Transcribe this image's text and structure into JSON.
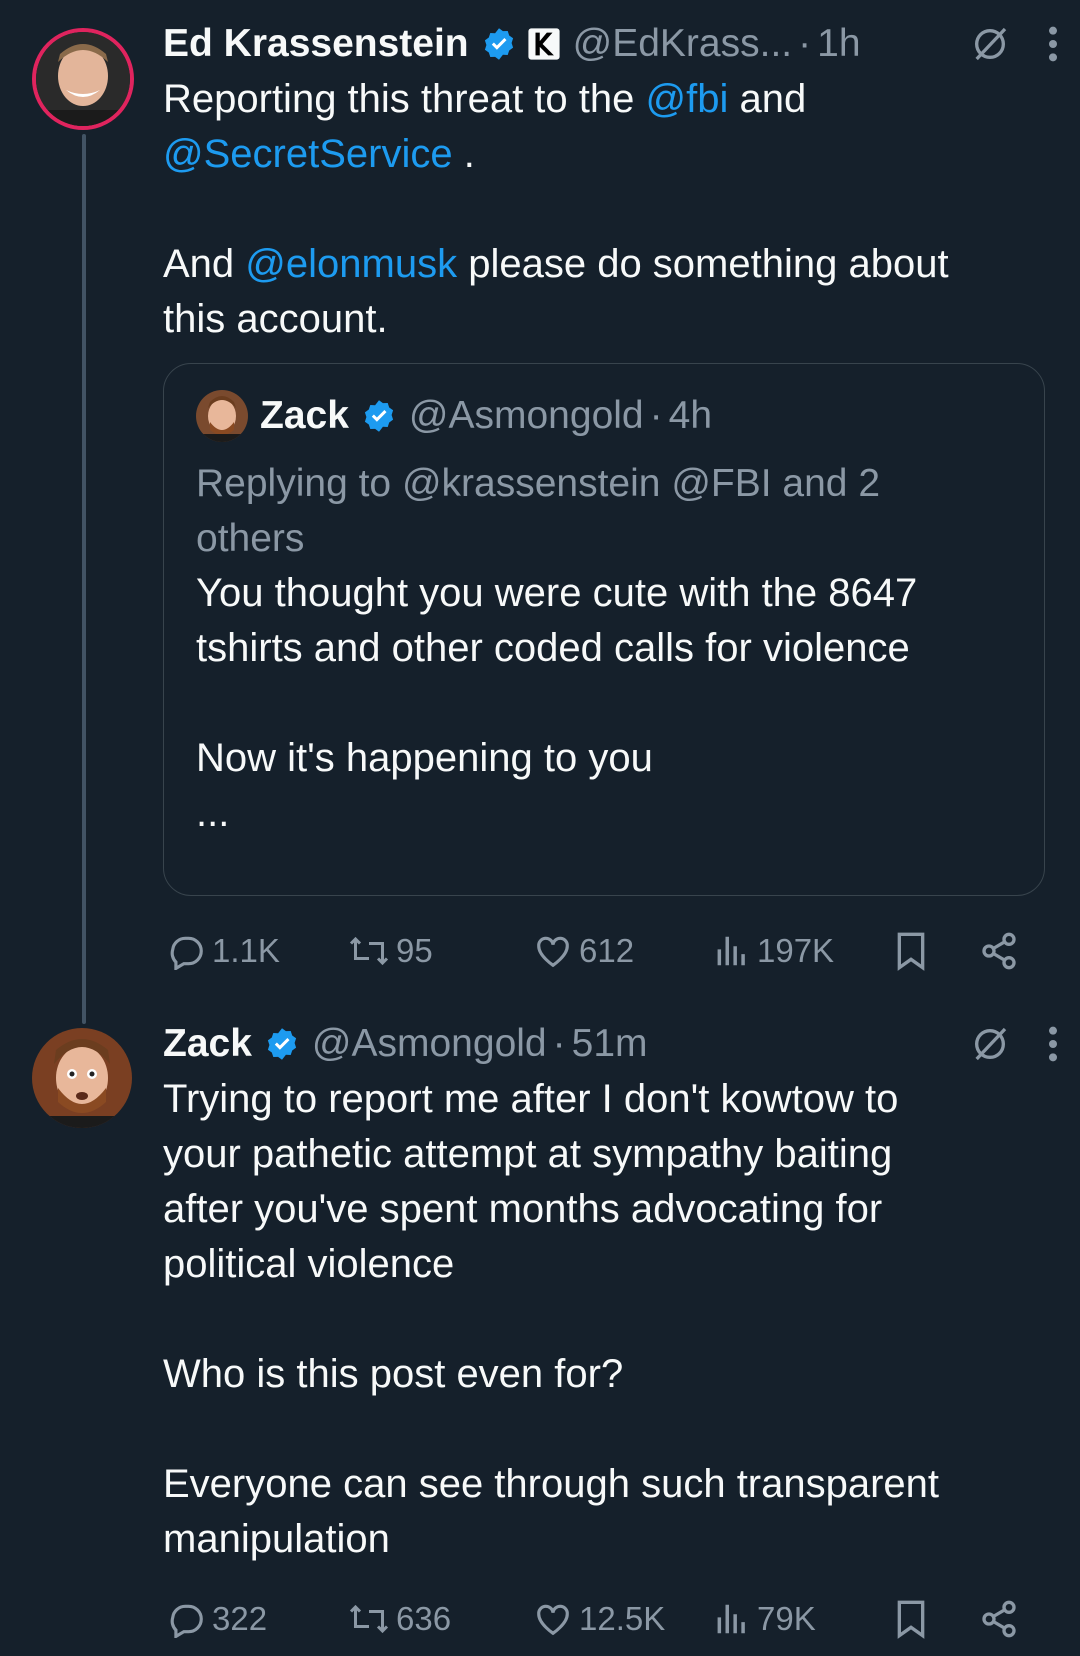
{
  "colors": {
    "background": "#15202b",
    "text": "#f7f9f9",
    "muted": "#8b98a5",
    "link": "#1d9bf0",
    "verified": "#1d9bf0",
    "avatar_ring": "#e0245e"
  },
  "tweet1": {
    "name": "Ed Krassenstein",
    "handle": "@EdKrass...",
    "dot": "·",
    "time": "1h",
    "text": {
      "p1_a": "Reporting this threat to the ",
      "p1_m1": "@fbi",
      "p1_b": " and ",
      "p1_m2": "@SecretService",
      "p1_c": " .",
      "p2_a": "And ",
      "p2_m1": "@elonmusk",
      "p2_b": " please do something about this account."
    },
    "quote": {
      "name": "Zack",
      "handle": "@Asmongold",
      "dot": "·",
      "time": "4h",
      "replying": "Replying to @krassenstein @FBI and 2 others",
      "p1": "You thought you were cute with the 8647 tshirts and other coded calls for violence",
      "p2": "Now it's happening to you",
      "ellipsis": "..."
    },
    "stats": {
      "replies": "1.1K",
      "reposts": "95",
      "likes": "612",
      "views": "197K"
    }
  },
  "tweet2": {
    "name": "Zack",
    "handle": "@Asmongold",
    "dot": "·",
    "time": "51m",
    "p1": "Trying to report me after I don't kowtow to your pathetic attempt at sympathy baiting after you've spent months advocating for political violence",
    "p2": "Who is this post even for?",
    "p3": "Everyone can see through such transparent manipulation",
    "stats": {
      "replies": "322",
      "reposts": "636",
      "likes": "12.5K",
      "views": "79K"
    }
  },
  "icons": [
    "verified-badge-icon",
    "affiliate-k-icon",
    "grok-icon",
    "more-icon",
    "reply-icon",
    "repost-icon",
    "like-icon",
    "views-icon",
    "bookmark-icon",
    "share-icon"
  ]
}
